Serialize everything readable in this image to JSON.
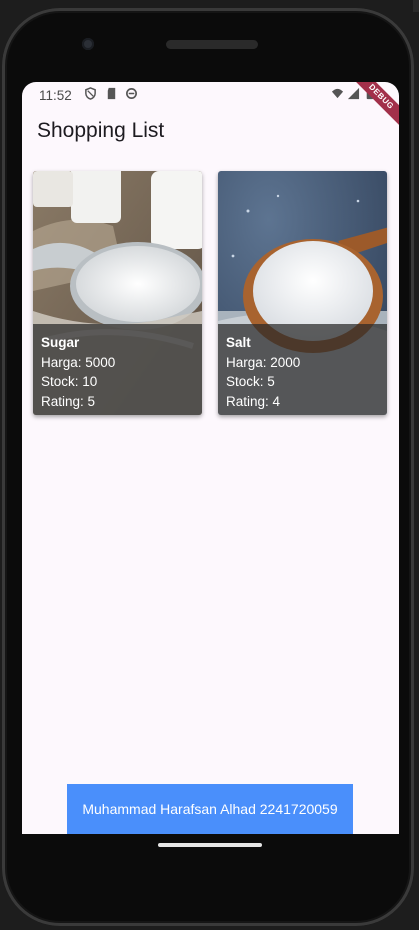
{
  "status_bar": {
    "time": "11:52",
    "debug_label": "DEBUG"
  },
  "app": {
    "title": "Shopping List"
  },
  "products": [
    {
      "name": "Sugar",
      "price": "Harga: 5000",
      "stock": "Stock: 10",
      "rating": "Rating: 5",
      "image": "sugar-cubes-and-spoon"
    },
    {
      "name": "Salt",
      "price": "Harga: 2000",
      "stock": "Stock: 5",
      "rating": "Rating: 4",
      "image": "salt-in-wooden-spoon"
    }
  ],
  "footer": {
    "text": "Muhammad Harafsan Alhad 2241720059"
  },
  "colors": {
    "footer_bg": "#4a8ffb",
    "screen_bg": "#fdf8fd",
    "debug_banner": "#a2304a"
  }
}
